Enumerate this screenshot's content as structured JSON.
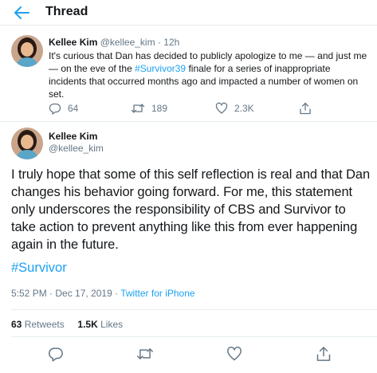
{
  "header": {
    "title": "Thread"
  },
  "colors": {
    "accent": "#1da1f2",
    "muted": "#657786",
    "text": "#14171a",
    "border": "#e6ecf0"
  },
  "tweet1": {
    "name": "Kellee Kim",
    "handle": "@kellee_kim",
    "separator": "·",
    "time": "12h",
    "text_before": "It's curious that Dan has decided to publicly apologize to me — and just me — on the eve of the ",
    "hashtag": "#Survivor39",
    "text_after": " finale for a series of inappropriate incidents that occurred months ago and impacted a number of women on set.",
    "replies": "64",
    "retweets": "189",
    "likes": "2.3K"
  },
  "tweet2": {
    "name": "Kellee Kim",
    "handle": "@kellee_kim",
    "text": "I truly hope that some of this self reflection is real and that Dan changes his behavior going forward. For me, this statement only underscores the responsibility of CBS and Survivor to take action to prevent anything like this from ever happening again in the future.",
    "hashtag": "#Survivor",
    "timestamp": "5:52 PM · Dec 17, 2019 · ",
    "source": "Twitter for iPhone",
    "retweets_count": "63",
    "retweets_label": "Retweets",
    "likes_count": "1.5K",
    "likes_label": "Likes"
  },
  "icons": {
    "back": "arrow-left-icon",
    "reply": "reply-icon",
    "retweet": "retweet-icon",
    "like": "heart-icon",
    "share": "share-icon"
  }
}
